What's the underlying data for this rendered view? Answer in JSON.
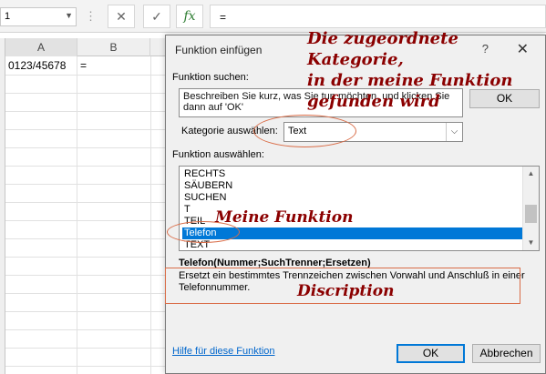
{
  "spreadsheet": {
    "name_box": "1",
    "formula_icons": [
      "close-icon",
      "check-icon",
      "fx-icon"
    ],
    "fx_label": "fx",
    "cancel_glyph": "✕",
    "enter_glyph": "✓",
    "formula": "=",
    "columns": [
      "A",
      "B"
    ],
    "cells": {
      "A1": "0123/45678",
      "B1": "="
    }
  },
  "dialog": {
    "title": "Funktion einfügen",
    "help_glyph": "?",
    "close_glyph": "✕",
    "search_label": "Funktion suchen:",
    "search_text": "Beschreiben Sie kurz, was Sie tun möchten, und klicken Sie dann auf 'OK'",
    "go_button": "OK",
    "category_label": "Kategorie auswählen:",
    "category_value": "Text",
    "function_list_label": "Funktion auswählen:",
    "functions": [
      "RECHTS",
      "SÄUBERN",
      "SUCHEN",
      "T",
      "TEIL",
      "Telefon",
      "TEXT"
    ],
    "selected_function": "Telefon",
    "signature": "Telefon(Nummer;SuchTrenner;Ersetzen)",
    "description": "Ersetzt ein bestimmtes Trennzeichen zwischen Vorwahl und Anschluß in einer Telefonnummer.",
    "help_link": "Hilfe für diese Funktion",
    "ok_button": "OK",
    "cancel_button": "Abbrechen"
  },
  "annotations": {
    "category_note": [
      "Die zugeordnete",
      "Kategorie,",
      "in der meine Funktion",
      "gefunden wird"
    ],
    "function_note": "Meine Funktion",
    "description_note": "Discription",
    "color": "#8b0000",
    "highlight_color": "#d96c47"
  }
}
